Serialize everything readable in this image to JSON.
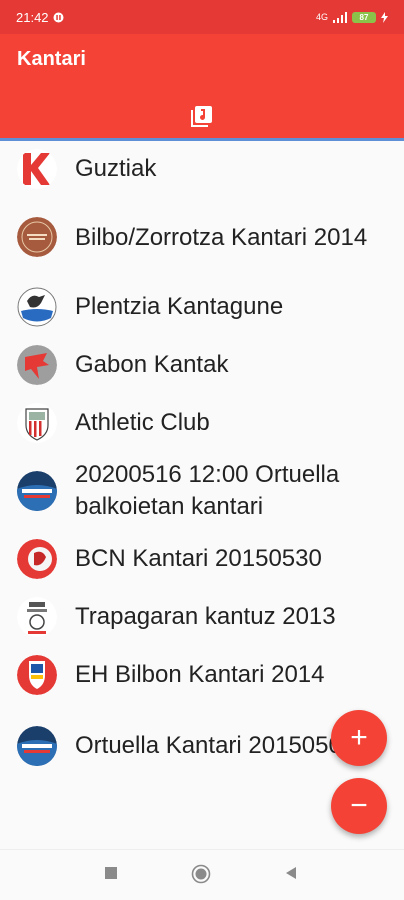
{
  "status_bar": {
    "time": "21:42",
    "signal_text": "4G",
    "battery": "87"
  },
  "app_bar": {
    "title": "Kantari",
    "tab_icon": "music-library-icon"
  },
  "list": {
    "items": [
      {
        "label": "Guztiak",
        "avatar": "kantari-logo"
      },
      {
        "label": "Bilbo/Zorrotza Kantari 2014",
        "avatar": "bilbo-kantari-logo"
      },
      {
        "label": "Plentzia Kantagune",
        "avatar": "plentzia-logo"
      },
      {
        "label": "Gabon Kantak",
        "avatar": "gabon-kantak-logo"
      },
      {
        "label": "Athletic Club",
        "avatar": "athletic-club-crest"
      },
      {
        "label": "20200516 12:00 Ortuella balkoietan kantari",
        "avatar": "kantu-kalean-logo"
      },
      {
        "label": "BCN Kantari 20150530",
        "avatar": "bcn-kantari-logo"
      },
      {
        "label": "Trapagaran kantuz 2013",
        "avatar": "trapagaran-logo"
      },
      {
        "label": "EH Bilbon Kantari 2014",
        "avatar": "eh-bilbon-logo"
      },
      {
        "label": "Ortuella Kantari 20150509",
        "avatar": "kantu-kalean-logo"
      }
    ]
  },
  "fab": {
    "plus": "+",
    "minus": "−"
  },
  "colors": {
    "primary": "#f44336",
    "status_bar": "#e53935",
    "tab_indicator": "#5c8fd6"
  }
}
